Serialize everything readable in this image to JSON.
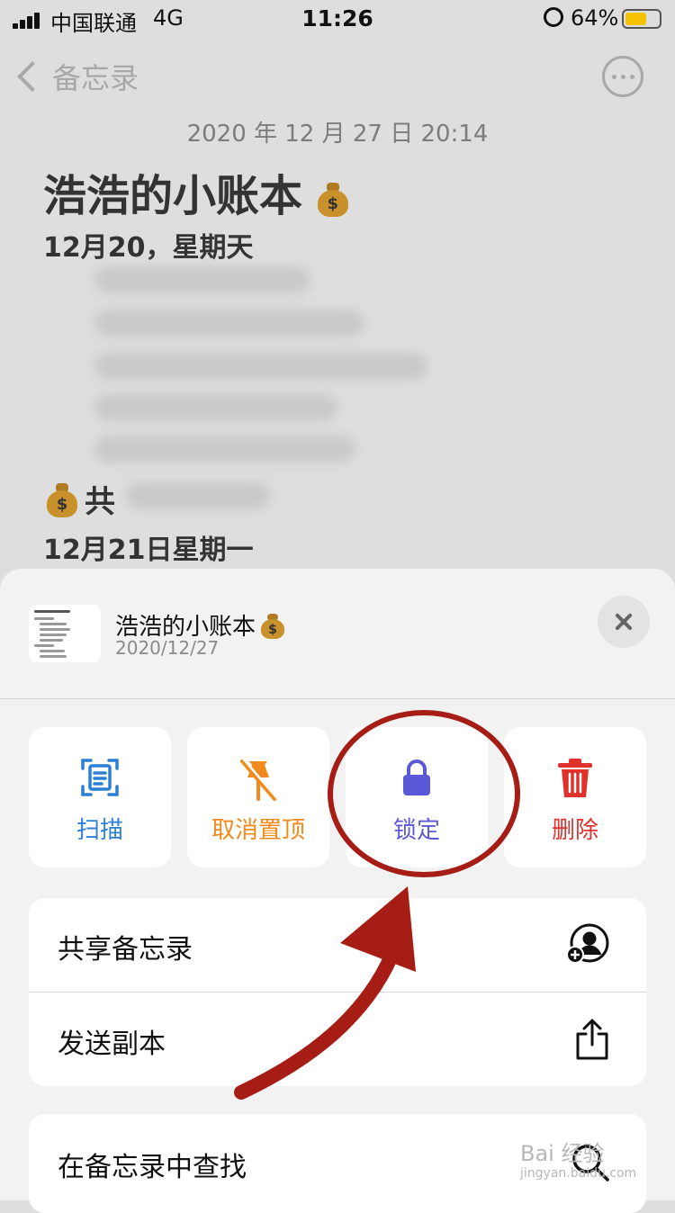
{
  "status_bar": {
    "carrier": "中国联通",
    "network": "4G",
    "time": "11:26",
    "battery": "64%",
    "battery_level": 0.64,
    "battery_color": "#f5c400"
  },
  "nav": {
    "back_label": "备忘录"
  },
  "note": {
    "date": "2020 年 12 月 27 日 20:14",
    "title": "浩浩的小账本",
    "first_day": "12月20，星期天",
    "section_heading": "共",
    "second_day": "12月21日星期一"
  },
  "sheet": {
    "note_title": "浩浩的小账本",
    "note_date": "2020/12/27",
    "actions": [
      {
        "label": "扫描",
        "icon": "scan-icon",
        "color": "#2b7fd4"
      },
      {
        "label": "取消置顶",
        "icon": "unpin-icon",
        "color": "#f08a1c"
      },
      {
        "label": "锁定",
        "icon": "lock-icon",
        "color": "#5a58d6"
      },
      {
        "label": "删除",
        "icon": "trash-icon",
        "color": "#e0322d"
      }
    ],
    "list_group_1": [
      {
        "label": "共享备忘录",
        "icon": "share-person-icon"
      },
      {
        "label": "发送副本",
        "icon": "share-icon"
      }
    ],
    "list_group_2": [
      {
        "label": "在备忘录中查找",
        "icon": "search-icon"
      }
    ]
  },
  "annotation": {
    "color": "#a51d14"
  },
  "watermark": {
    "text": "Bai 经验",
    "url": "jingyan.baidu.com"
  }
}
